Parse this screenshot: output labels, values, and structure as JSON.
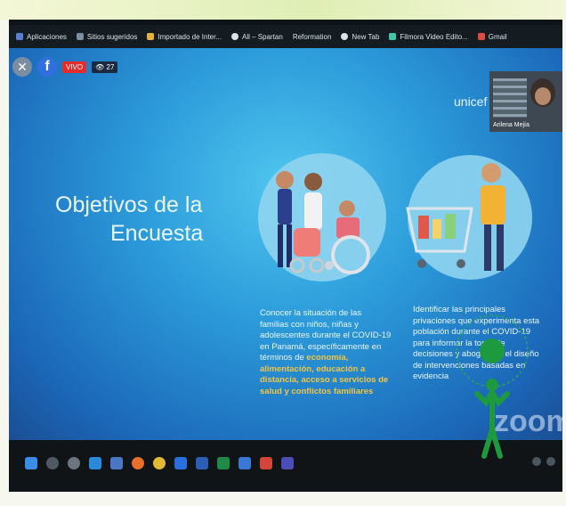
{
  "bookmarks": [
    {
      "label": "Aplicaciones",
      "icon": "apps-icon"
    },
    {
      "label": "Sitios sugeridos",
      "icon": "suggested-sites-icon"
    },
    {
      "label": "Importado de Inter...",
      "icon": "folder-icon"
    },
    {
      "label": "All – Spartan",
      "icon": "globe-icon"
    },
    {
      "label": "Reformation",
      "icon": "globe-icon"
    },
    {
      "label": "New Tab",
      "icon": "globe-icon"
    },
    {
      "label": "Filmora Video Edito...",
      "icon": "filmora-icon"
    },
    {
      "label": "Gmail",
      "icon": "gmail-icon"
    }
  ],
  "stream": {
    "live_label": "VIVO",
    "views": "27"
  },
  "slide": {
    "brand": "unicef",
    "title_line1": "Objetivos de la",
    "title_line2": "Encuesta",
    "left_text": "Conocer la situación de las familias con niños, niñas y adolescentes durante el COVID-19 en Panamá, específicamente en términos de ",
    "left_highlight": "economía, alimentación, educación a distancia, acceso a servicios de salud y conflictos familiares",
    "right_text": "Identificar las principales privaciones que experimenta esta población durante el COVID-19 para informar la toma de decisiones y abogar por el diseño de intervenciones basadas en evidencia"
  },
  "participant": {
    "name": "Arilena Mejía"
  },
  "watermark": "zoom",
  "colors": {
    "slide_blue": "#2b99d9",
    "highlight": "#f2c542",
    "live_red": "#e32c2c"
  }
}
